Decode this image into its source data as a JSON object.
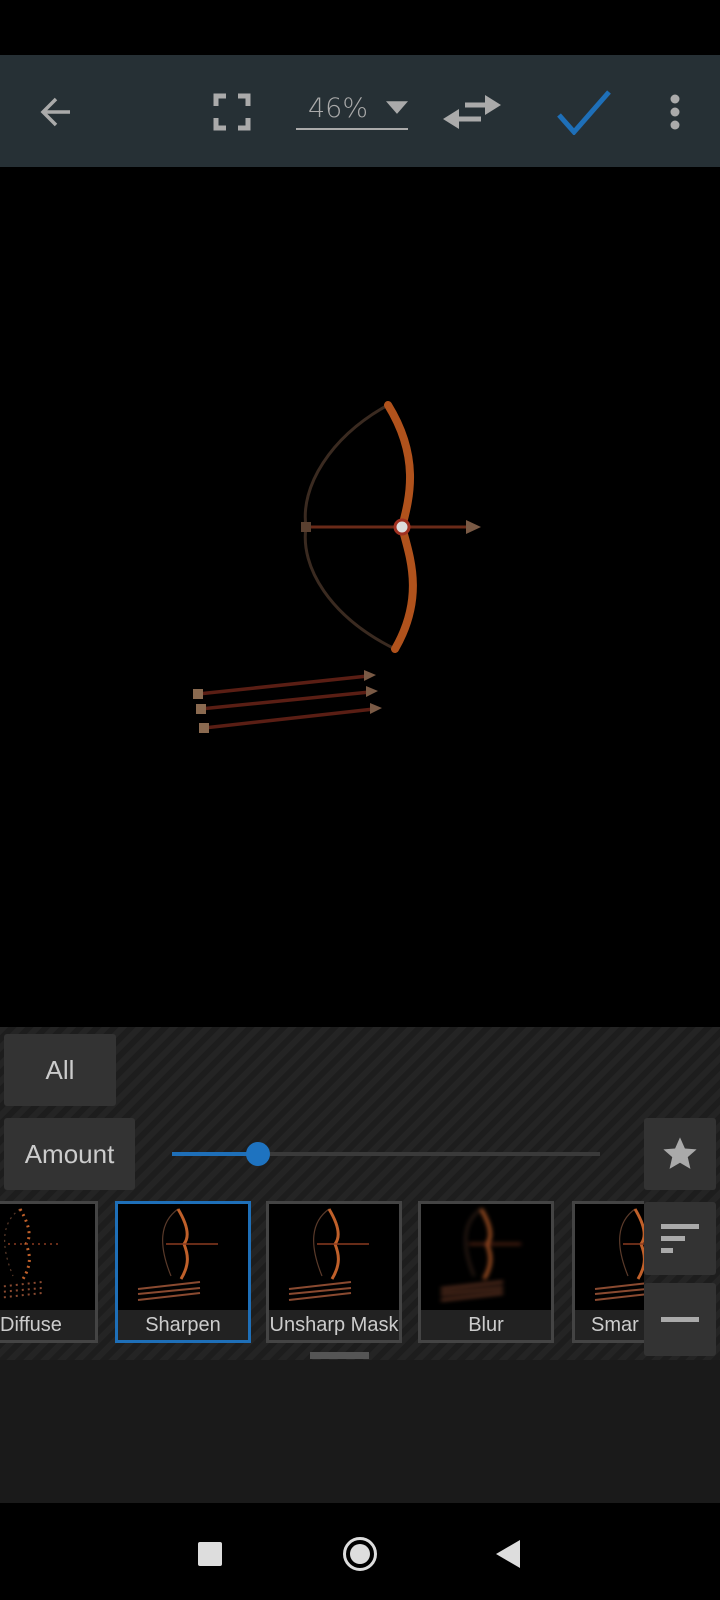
{
  "toolbar": {
    "zoom_level": "46%",
    "icons": [
      "back-arrow-icon",
      "fullscreen-icon",
      "dropdown-triangle-icon",
      "swap-icon",
      "checkmark-icon",
      "more-vert-icon"
    ],
    "accent": "#1e6fb8"
  },
  "panel": {
    "category_button": "All",
    "param_button": "Amount",
    "slider": {
      "value_fraction": 0.2
    },
    "filters": [
      {
        "label": "Diffuse"
      },
      {
        "label": "Sharpen",
        "selected": true
      },
      {
        "label": "Unsharp Mask"
      },
      {
        "label": "Blur"
      },
      {
        "label": "Smar"
      }
    ],
    "side_icons": [
      "star-icon",
      "sort-icon",
      "minus-icon"
    ]
  },
  "navbar": {
    "icons": [
      "recents-square-icon",
      "home-circle-icon",
      "back-triangle-icon"
    ]
  }
}
